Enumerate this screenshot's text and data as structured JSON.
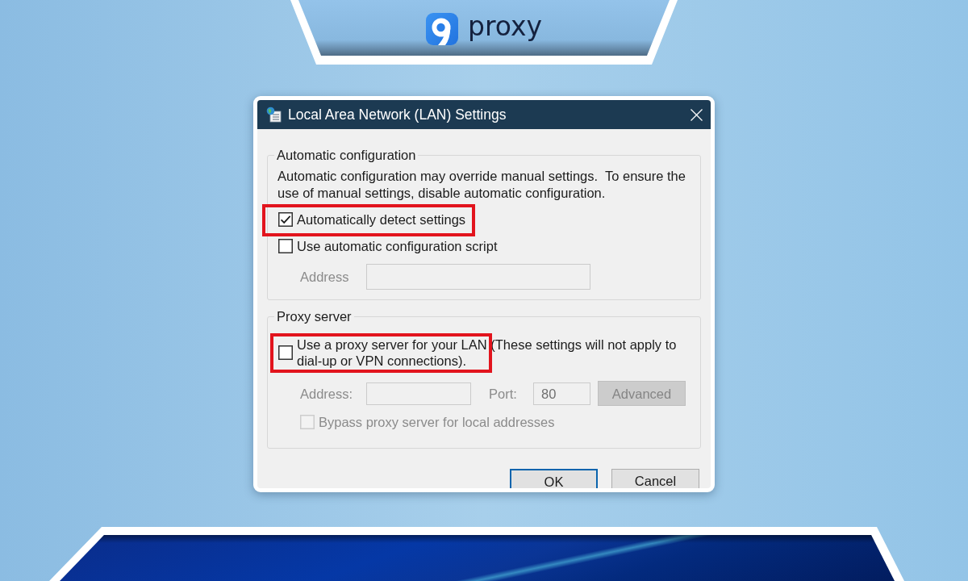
{
  "logo": {
    "text": "proxy"
  },
  "dialog": {
    "title": "Local Area Network (LAN) Settings",
    "automatic_configuration": {
      "legend": "Automatic configuration",
      "description": "Automatic configuration may override manual settings.  To ensure the use of manual settings, disable automatic configuration.",
      "options": [
        {
          "label": "Automatically detect settings",
          "checked": true,
          "highlighted": true
        },
        {
          "label": "Use automatic configuration script",
          "checked": false,
          "highlighted": false
        }
      ],
      "address": {
        "label": "Address",
        "disabled": true
      }
    },
    "proxy_server": {
      "legend": "Proxy server",
      "use_proxy": {
        "label": "Use a proxy server for your LAN (These settings will not apply to dial-up or VPN connections).",
        "checked": false,
        "highlighted": true
      },
      "address": {
        "label": "Address:",
        "disabled": true
      },
      "port": {
        "label": "Port:",
        "value": "80",
        "disabled": true
      },
      "advanced_button": {
        "label": "Advanced",
        "disabled": true
      },
      "bypass": {
        "label": "Bypass proxy server for local addresses",
        "checked": false,
        "disabled": true
      }
    },
    "buttons": [
      {
        "label": "OK",
        "focused": true
      },
      {
        "label": "Cancel",
        "focused": false
      }
    ]
  }
}
